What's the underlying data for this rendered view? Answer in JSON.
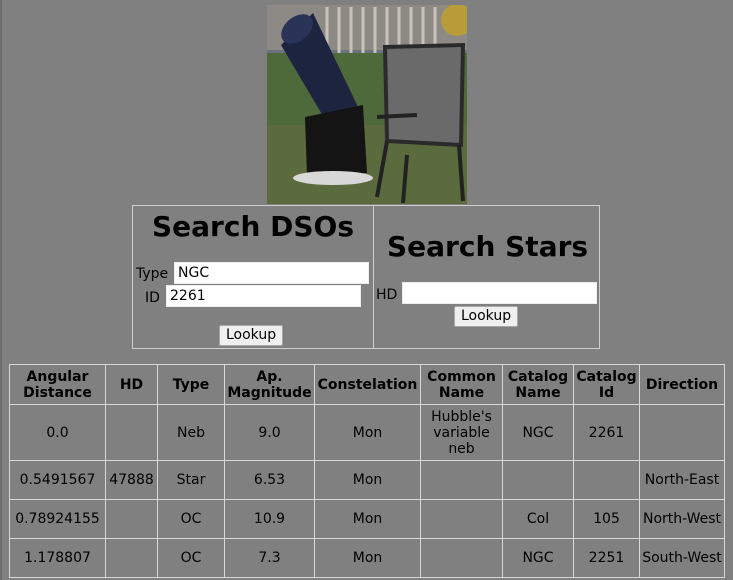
{
  "dso_search": {
    "title": "Search DSOs",
    "type_label": "Type",
    "type_value": "NGC",
    "id_label": "ID",
    "id_value": "2261",
    "button_label": "Lookup"
  },
  "star_search": {
    "title": "Search Stars",
    "hd_label": "HD",
    "hd_value": "",
    "button_label": "Lookup"
  },
  "results": {
    "headers": [
      "Angular Distance",
      "HD",
      "Type",
      "Ap. Magnitude",
      "Constelation",
      "Common Name",
      "Catalog Name",
      "Catalog Id",
      "Direction"
    ],
    "rows": [
      [
        "0.0",
        "",
        "Neb",
        "9.0",
        "Mon",
        "Hubble's variable neb",
        "NGC",
        "2261",
        ""
      ],
      [
        "0.5491567",
        "47888",
        "Star",
        "6.53",
        "Mon",
        "",
        "",
        "",
        "North-East"
      ],
      [
        "0.78924155",
        "",
        "OC",
        "10.9",
        "Mon",
        "",
        "Col",
        "105",
        "North-West"
      ],
      [
        "1.178807",
        "",
        "OC",
        "7.3",
        "Mon",
        "",
        "NGC",
        "2251",
        "South-West"
      ]
    ]
  }
}
